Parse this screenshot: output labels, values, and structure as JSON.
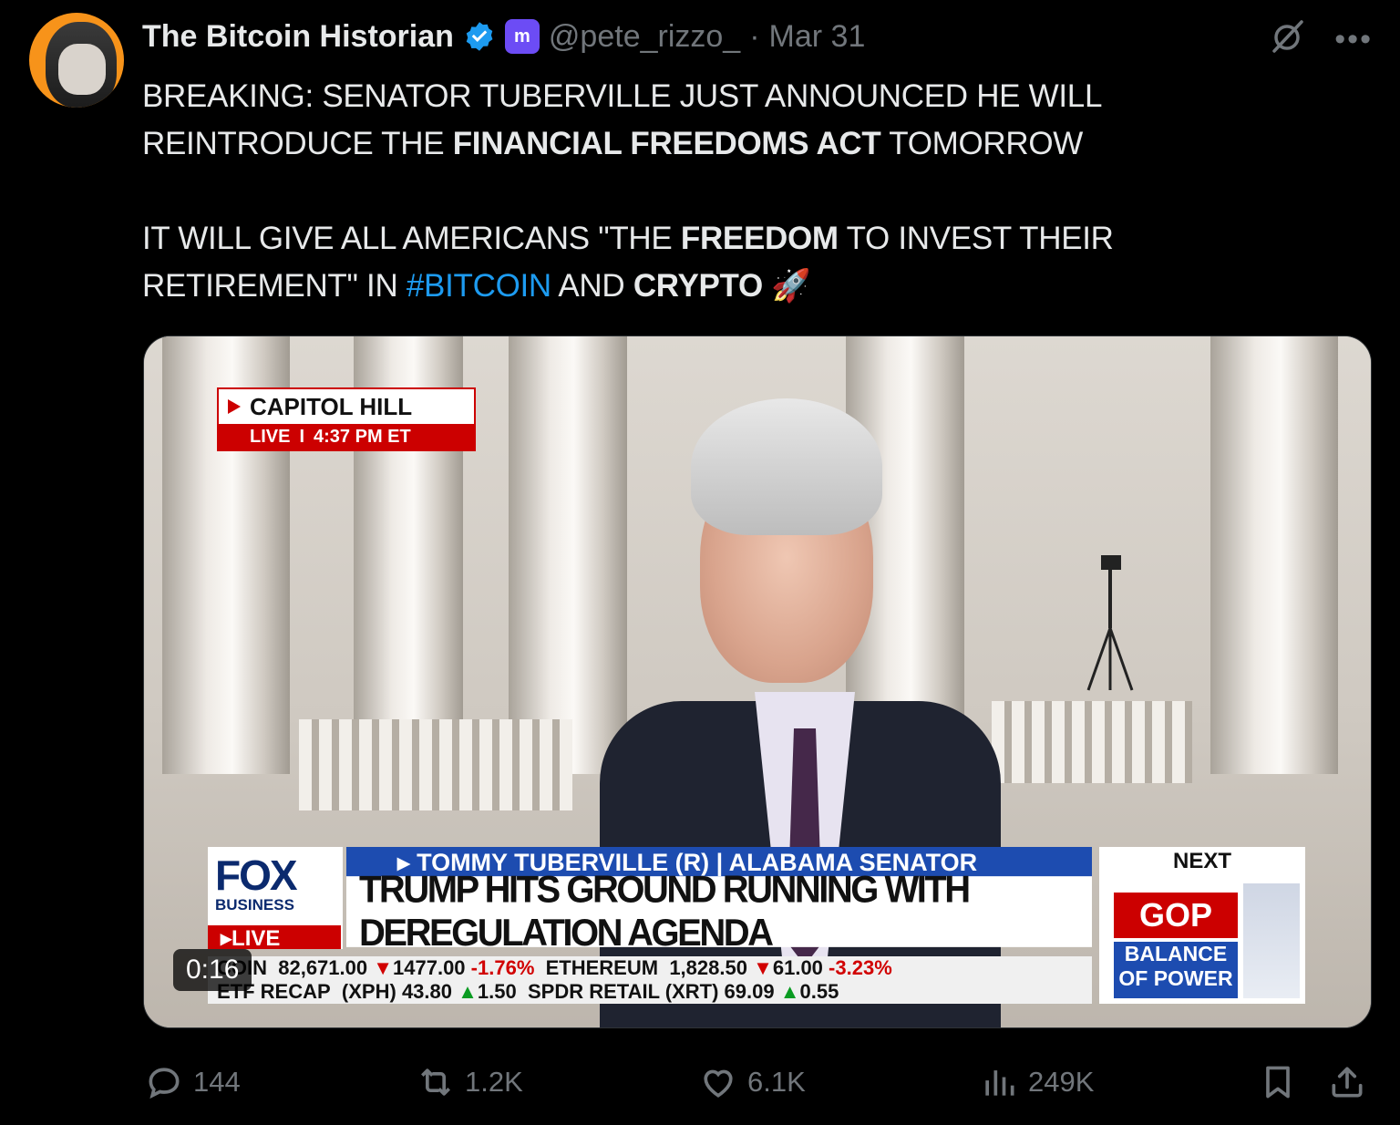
{
  "author": {
    "display_name": "The Bitcoin Historian",
    "handle": "@pete_rizzo_",
    "separator": "·",
    "date": "Mar 31",
    "badge_letter": "m"
  },
  "tweet": {
    "line1": "BREAKING: SENATOR TUBERVILLE JUST ANNOUNCED HE WILL",
    "line2_pre": "REINTRODUCE THE ",
    "line2_bold": "FINANCIAL FREEDOMS ACT",
    "line2_post": " TOMORROW",
    "line3_pre": "IT WILL GIVE ALL AMERICANS \"THE ",
    "line3_bold": "FREEDOM",
    "line3_post": " TO INVEST THEIR",
    "line4_pre": "RETIREMENT\" IN ",
    "line4_hashtag": "#BITCOIN",
    "line4_mid": " AND ",
    "line4_bold": "CRYPTO",
    "emoji": "🚀"
  },
  "video": {
    "timestamp": "0:16",
    "bug_location": "CAPITOL HILL",
    "bug_live": "LIVE",
    "bug_divider": "I",
    "bug_time": "4:37 PM ET",
    "network": "FOX",
    "network_sub": "BUSINESS",
    "network_live": "LIVE",
    "name_line": "TOMMY TUBERVILLE (R) | ALABAMA SENATOR",
    "headline": "TRUMP HITS GROUND RUNNING WITH DEREGULATION AGENDA",
    "ticker_row1": [
      "COIN",
      "82,671.00",
      "1477.00",
      "-1.76%",
      "ETHEREUM",
      "1,828.50",
      "61.00",
      "-3.23%"
    ],
    "ticker_row2": [
      "ETF RECAP",
      "(XPH)",
      "43.80",
      "1.50",
      "SPDR RETAIL",
      "(XRT)",
      "69.09",
      "0.55"
    ],
    "next_label": "NEXT",
    "next_gop": "GOP",
    "next_bop": "BALANCE OF POWER"
  },
  "metrics": {
    "replies": "144",
    "reposts": "1.2K",
    "likes": "6.1K",
    "views": "249K"
  },
  "colors": {
    "background": "#000000",
    "text": "#e7e9ea",
    "muted": "#71767b",
    "accent": "#1d9bf0",
    "verified": "#1d9bf0"
  },
  "icons": [
    "verified-icon",
    "grok-icon",
    "more-icon",
    "reply-icon",
    "repost-icon",
    "like-icon",
    "views-icon",
    "bookmark-icon",
    "share-icon"
  ]
}
